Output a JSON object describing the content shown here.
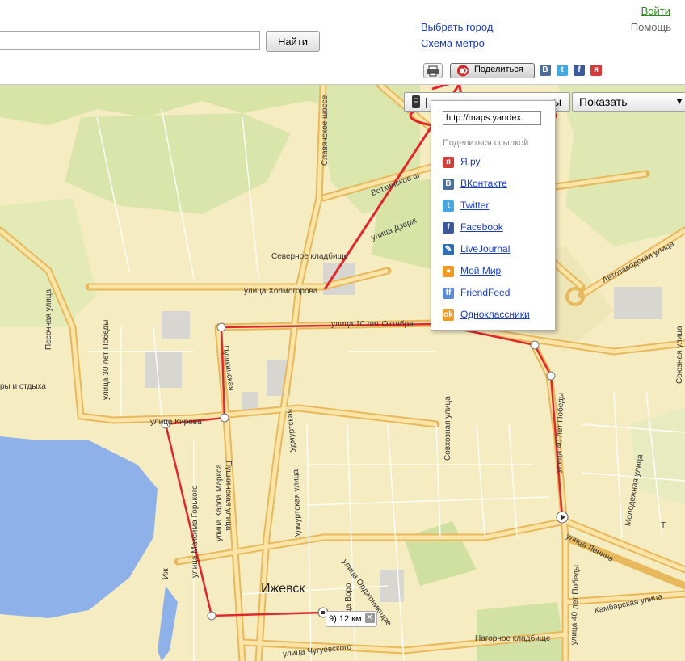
{
  "header": {
    "search_button": "Найти",
    "search_value": "",
    "links": {
      "choose_city": "Выбрать город",
      "metro_map": "Схема метро"
    },
    "login": "Войти",
    "help": "Помощь"
  },
  "toolbar": {
    "share_label": "Поделиться",
    "social": [
      {
        "icon": "vkontakte-icon",
        "glyph": "B",
        "color": "#4a6f99"
      },
      {
        "icon": "twitter-icon",
        "glyph": "t",
        "color": "#44a8e0"
      },
      {
        "icon": "facebook-icon",
        "glyph": "f",
        "color": "#3b5998"
      },
      {
        "icon": "yaru-icon",
        "glyph": "я",
        "color": "#d43b3b"
      }
    ]
  },
  "map_controls": {
    "show_label": "Показать",
    "layers_partial": "ы"
  },
  "share_popup": {
    "url_value": "http://maps.yandex.",
    "header": "Поделиться ссылкой",
    "items": [
      {
        "label": "Я.ру",
        "icon": "yaru-icon",
        "glyph": "я",
        "color": "#d43b3b"
      },
      {
        "label": "ВКонтакте",
        "icon": "vkontakte-icon",
        "glyph": "B",
        "color": "#4a6f99"
      },
      {
        "label": "Twitter",
        "icon": "twitter-icon",
        "glyph": "t",
        "color": "#44a8e0"
      },
      {
        "label": "Facebook",
        "icon": "facebook-icon",
        "glyph": "f",
        "color": "#3b5998"
      },
      {
        "label": "LiveJournal",
        "icon": "livejournal-icon",
        "glyph": "✎",
        "color": "#2f6fb5"
      },
      {
        "label": "Мой Мир",
        "icon": "moymir-icon",
        "glyph": "●",
        "color": "#f29a1f"
      },
      {
        "label": "FriendFeed",
        "icon": "friendfeed-icon",
        "glyph": "ff",
        "color": "#5a8bd8"
      },
      {
        "label": "Одноклассники",
        "icon": "odnoklassniki-icon",
        "glyph": "ok",
        "color": "#f29a1f"
      }
    ]
  },
  "map": {
    "city": "Ижевск",
    "distance_label": "9) 12 км",
    "streets": {
      "kholmogorova": "улица Холмогорова",
      "oktyabrya": "улица 10 лет Октября",
      "kirova": "улица Кирова",
      "lenina": "улица Ленина",
      "chugueva": "улица Чугуевского",
      "ordzhonikidze": "улица Орджоникидзе",
      "dzerzhinskogo": "улица Дзерж",
      "avtozavodskaya": "Автозаводская улица",
      "kambarskaya": "Камбарская улица",
      "votkinskoe": "Воткинское ш",
      "slavyanskoe": "Славянское шоссе",
      "pushkinskaya": "Пушкинская улица",
      "pushkinskaya2": "Пушкинская",
      "udmurtskaya": "Удмуртская улица",
      "udmurtskaya2": "Удмуртская",
      "karla_marksa": "улица Карла Маркса",
      "maksima_gorkogo": "улица Максима Горького",
      "sovkhoznaya": "Совхозная улица",
      "pobedy30": "улица 30 лет Победы",
      "pobedy40": "улица 40 лет Победы",
      "pobedy40b": "улица 40 лет Победы",
      "pesochnaya": "Песочная улица",
      "molodezhnaya": "Молодежная улица",
      "soyuznaya": "Союзная улица",
      "vor": "улица Воро",
      "cemetery_north": "Северное кладбище",
      "cemetery_mountain": "Нагорное кладбище",
      "park": "ры и отдыха",
      "iz": "Иж",
      "tr": "Т"
    }
  },
  "colors": {
    "route": "#e3262b",
    "annotation": "#e3262b",
    "water": "#8fb1ea",
    "road_major": "#f7d58e",
    "link": "#1a3dc1"
  }
}
